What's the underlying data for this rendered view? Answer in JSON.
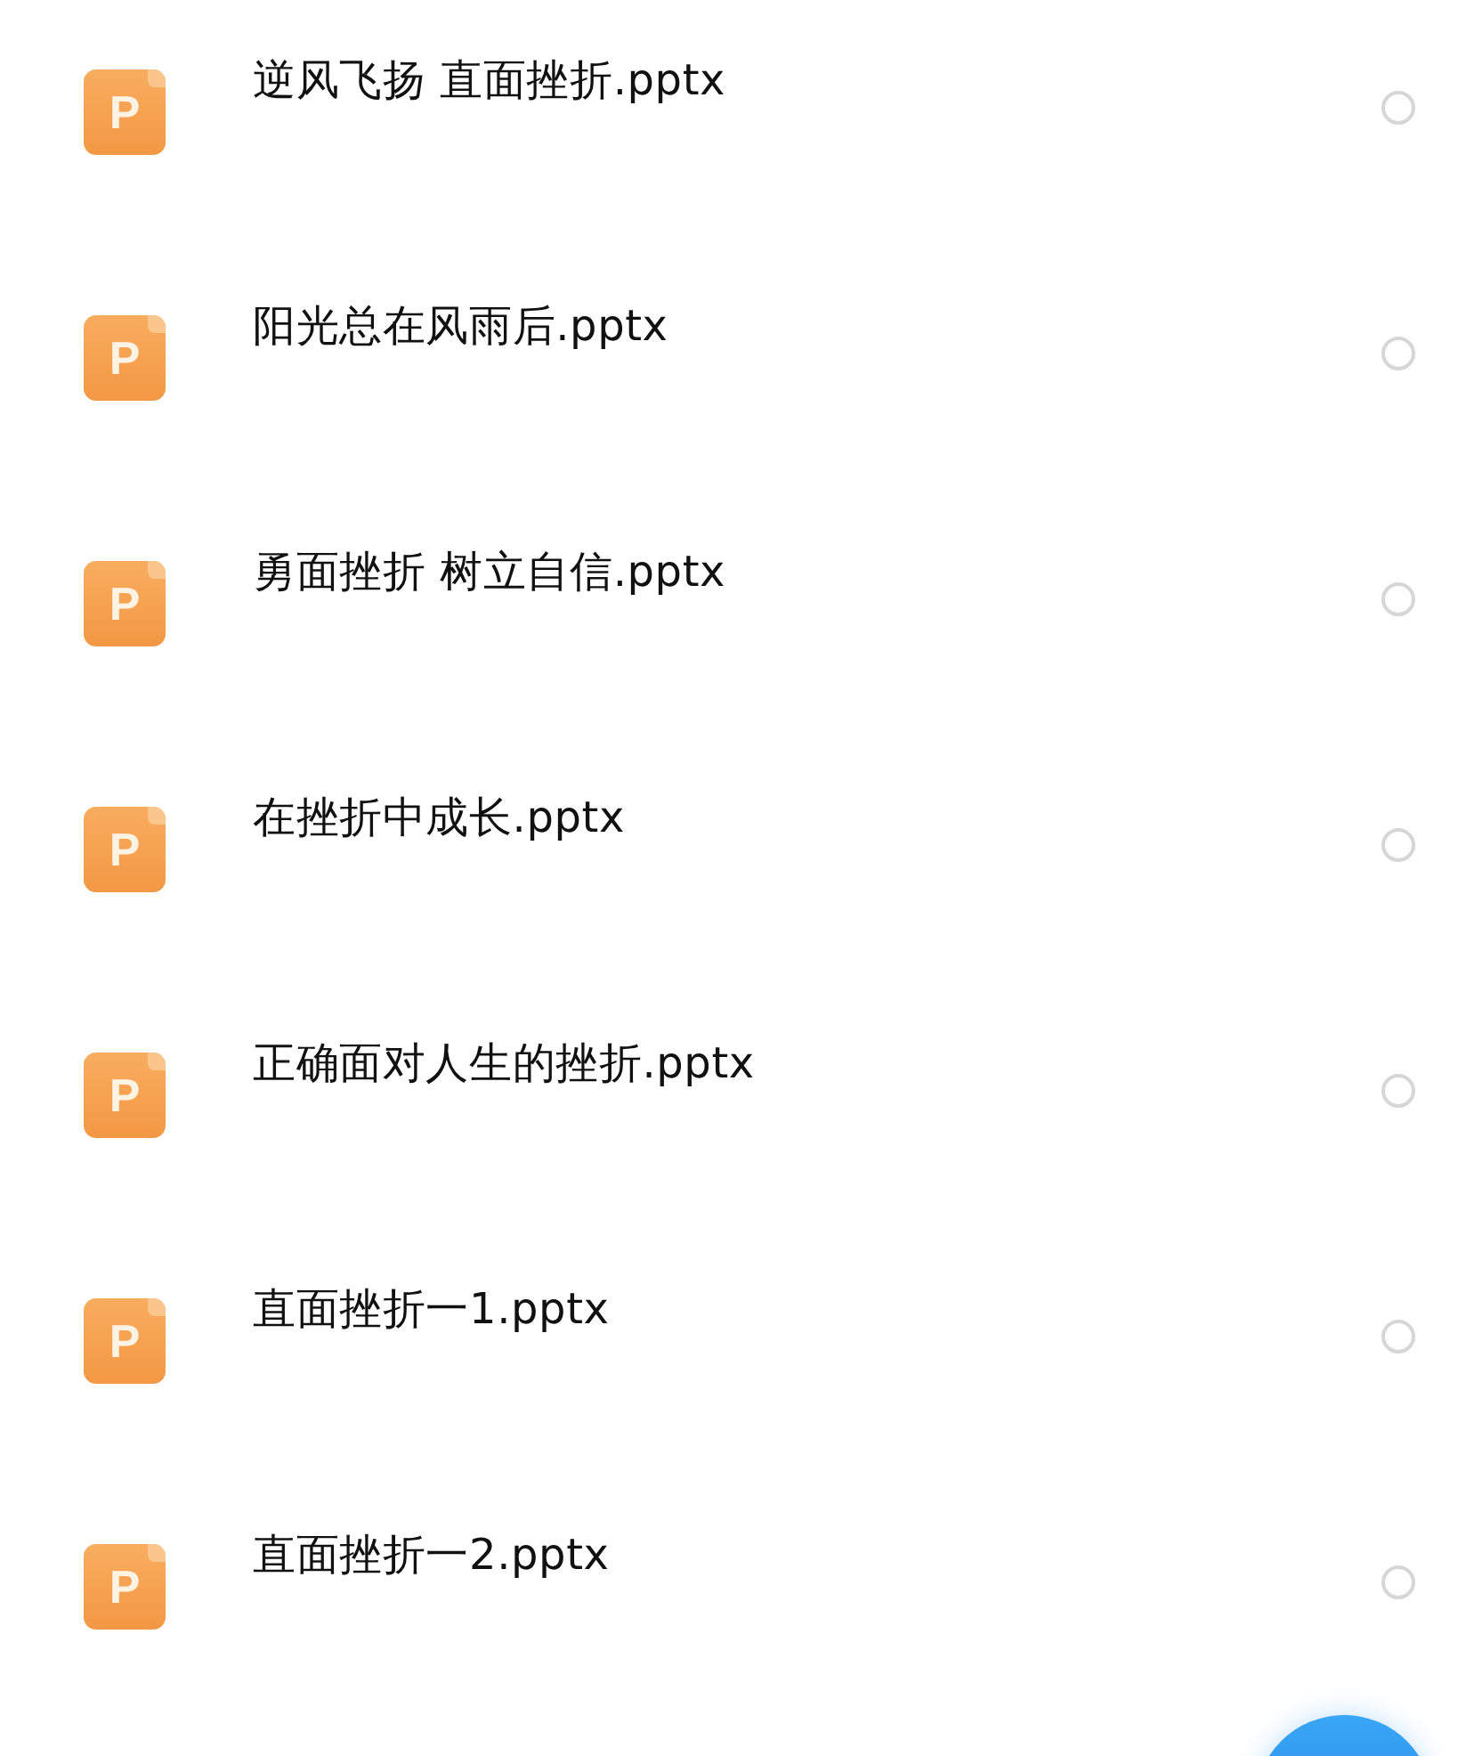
{
  "files": [
    {
      "name": "逆风飞扬 直面挫折.pptx",
      "icon_letter": "P",
      "selected": false
    },
    {
      "name": "阳光总在风雨后.pptx",
      "icon_letter": "P",
      "selected": false
    },
    {
      "name": "勇面挫折  树立自信.pptx",
      "icon_letter": "P",
      "selected": false
    },
    {
      "name": "在挫折中成长.pptx",
      "icon_letter": "P",
      "selected": false
    },
    {
      "name": "正确面对人生的挫折.pptx",
      "icon_letter": "P",
      "selected": false
    },
    {
      "name": "直面挫折一1.pptx",
      "icon_letter": "P",
      "selected": false
    },
    {
      "name": "直面挫折一2.pptx",
      "icon_letter": "P",
      "selected": false
    }
  ]
}
